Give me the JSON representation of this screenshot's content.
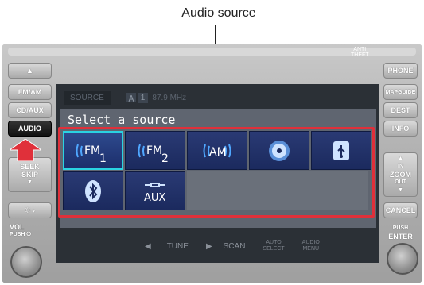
{
  "annotation": {
    "caption": "Audio source"
  },
  "unit": {
    "anti_theft_line1": "ANTI",
    "anti_theft_line2": "THEFT",
    "left_buttons": {
      "eject": "▲",
      "fm_am": "FM/AM",
      "cd_aux": "CD/AUX",
      "audio": "AUDIO",
      "seek_skip_line1": "SEEK",
      "seek_skip_line2": "SKIP",
      "preset": "❊ ›",
      "vol_line1": "VOL",
      "vol_line2": "PUSH ⏻"
    },
    "right_buttons": {
      "phone": "PHONE",
      "mapguide": "MAPGUIDE",
      "dest": "DEST",
      "info": "INFO",
      "zoom_in": "IN",
      "zoom": "ZOOM",
      "zoom_out": "OUT",
      "cancel": "CANCEL",
      "push_line1": "PUSH",
      "push_line2": "ENTER"
    }
  },
  "screen": {
    "status": {
      "source": "SOURCE",
      "channel": "1",
      "frequency": "87.9 MHz"
    },
    "dialog": {
      "title": "Select a source",
      "sources": [
        {
          "name": "FM1",
          "icon": "fm1-icon",
          "selected": true
        },
        {
          "name": "FM2",
          "icon": "fm2-icon",
          "selected": false
        },
        {
          "name": "AM",
          "icon": "am-icon",
          "selected": false
        },
        {
          "name": "CD",
          "icon": "disc-icon",
          "selected": false
        },
        {
          "name": "USB",
          "icon": "usb-icon",
          "selected": false
        },
        {
          "name": "Bluetooth",
          "icon": "bluetooth-icon",
          "selected": false
        },
        {
          "name": "AUX",
          "icon": "aux-icon",
          "selected": false
        }
      ]
    },
    "controls": {
      "tune": "TUNE",
      "scan": "SCAN",
      "auto_select_line1": "AUTO",
      "auto_select_line2": "SELECT",
      "audio_menu_line1": "AUDIO",
      "audio_menu_line2": "MENU"
    }
  },
  "colors": {
    "frame": "#e0303a",
    "selection": "#2ad3e2",
    "tile": "#1b2a5e",
    "callout_arrow": "#e0303a"
  }
}
